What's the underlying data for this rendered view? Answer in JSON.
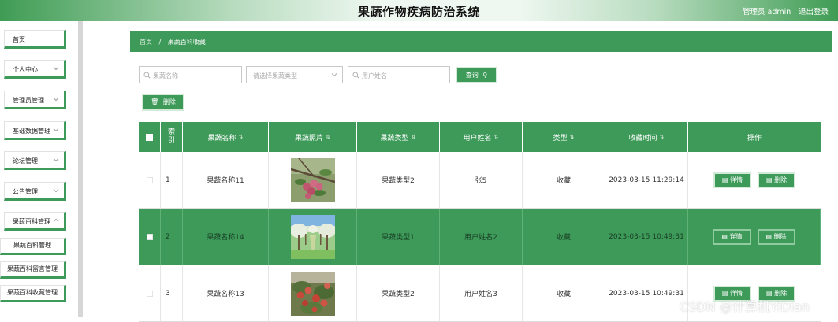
{
  "header": {
    "title": "果蔬作物疾病防治系统",
    "user": "管理员 admin",
    "logout": "退出登录"
  },
  "sidebar": {
    "items": [
      {
        "label": "首页",
        "has_chevron": false
      },
      {
        "label": "个人中心",
        "has_chevron": true
      },
      {
        "label": "管理员管理",
        "has_chevron": true
      },
      {
        "label": "基础数据管理",
        "has_chevron": true
      },
      {
        "label": "论坛管理",
        "has_chevron": true
      },
      {
        "label": "公告管理",
        "has_chevron": true
      },
      {
        "label": "果蔬百科管理",
        "has_chevron": true
      }
    ],
    "subitems": [
      {
        "label": "果蔬百科管理"
      },
      {
        "label": "果蔬百科留言管理"
      },
      {
        "label": "果蔬百科收藏管理"
      }
    ]
  },
  "breadcrumb": {
    "home": "首页",
    "separator": "/",
    "current": "果蔬百科收藏"
  },
  "search": {
    "name_placeholder": "果蔬名称",
    "type_placeholder": "请选择果蔬类型",
    "user_placeholder": "用户姓名",
    "query_label": "查询",
    "delete_label": "删除"
  },
  "table": {
    "columns": [
      "索引",
      "果蔬名称",
      "果蔬照片",
      "果蔬类型",
      "用户姓名",
      "类型",
      "收藏时间",
      "操作"
    ],
    "rows": [
      {
        "index": "1",
        "name": "果蔬名称11",
        "type": "果蔬类型2",
        "user": "张5",
        "kind": "收藏",
        "time": "2023-03-15 11:29:14",
        "photo": "pink-berries-on-branch",
        "highlight": false
      },
      {
        "index": "2",
        "name": "果蔬名称14",
        "type": "果蔬类型1",
        "user": "用户姓名2",
        "kind": "收藏",
        "time": "2023-03-15 10:49:31",
        "photo": "orchard-trees",
        "highlight": true
      },
      {
        "index": "3",
        "name": "果蔬名称13",
        "type": "果蔬类型2",
        "user": "用户姓名3",
        "kind": "收藏",
        "time": "2023-03-15 10:49:31",
        "photo": "red-apples-on-tree",
        "highlight": false
      }
    ],
    "detail_label": "详情",
    "delete_label": "删除"
  },
  "watermark": "CSDN @计算机YiDian",
  "colors": {
    "accent": "#3d9a59",
    "header_gradient_edge": "#3f9c54",
    "sidebar_divider": "#d6d6d6"
  }
}
